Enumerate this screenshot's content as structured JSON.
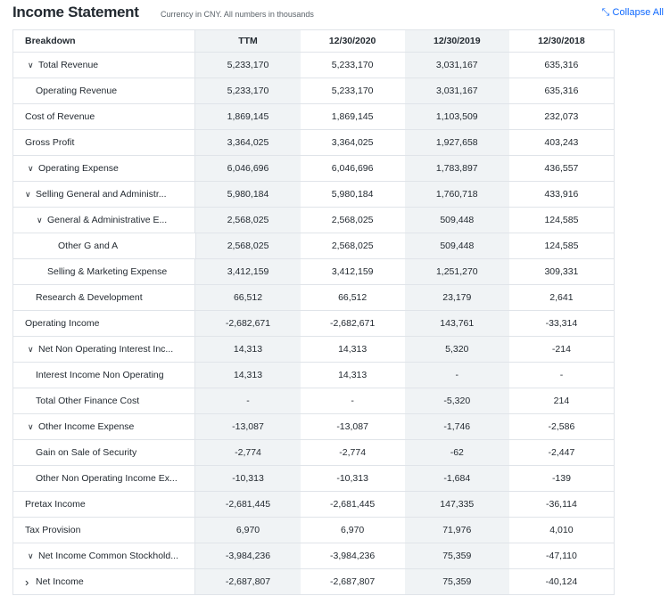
{
  "header": {
    "title": "Income Statement",
    "subtitle": "Currency in CNY. All numbers in thousands",
    "collapse_label": "Collapse All",
    "collapse_icon": "collapse-arrows-icon"
  },
  "columns": [
    "Breakdown",
    "TTM",
    "12/30/2020",
    "12/30/2019",
    "12/30/2018"
  ],
  "rows": [
    {
      "label": "Total Revenue",
      "level": 0,
      "caret": "down",
      "values": [
        "5,233,170",
        "5,233,170",
        "3,031,167",
        "635,316"
      ]
    },
    {
      "label": "Operating Revenue",
      "level": 1,
      "caret": "",
      "values": [
        "5,233,170",
        "5,233,170",
        "3,031,167",
        "635,316"
      ]
    },
    {
      "label": "Cost of Revenue",
      "level": 0,
      "caret": "",
      "values": [
        "1,869,145",
        "1,869,145",
        "1,103,509",
        "232,073"
      ]
    },
    {
      "label": "Gross Profit",
      "level": 0,
      "caret": "",
      "values": [
        "3,364,025",
        "3,364,025",
        "1,927,658",
        "403,243"
      ]
    },
    {
      "label": "Operating Expense",
      "level": 0,
      "caret": "down",
      "values": [
        "6,046,696",
        "6,046,696",
        "1,783,897",
        "436,557"
      ]
    },
    {
      "label": "Selling General and Administr...",
      "level": 1,
      "caret": "down",
      "values": [
        "5,980,184",
        "5,980,184",
        "1,760,718",
        "433,916"
      ]
    },
    {
      "label": "General & Administrative E...",
      "level": 2,
      "caret": "down",
      "values": [
        "2,568,025",
        "2,568,025",
        "509,448",
        "124,585"
      ]
    },
    {
      "label": "Other G and A",
      "level": 3,
      "caret": "",
      "values": [
        "2,568,025",
        "2,568,025",
        "509,448",
        "124,585"
      ]
    },
    {
      "label": "Selling & Marketing Expense",
      "level": 2,
      "caret": "",
      "values": [
        "3,412,159",
        "3,412,159",
        "1,251,270",
        "309,331"
      ]
    },
    {
      "label": "Research & Development",
      "level": 1,
      "caret": "",
      "values": [
        "66,512",
        "66,512",
        "23,179",
        "2,641"
      ]
    },
    {
      "label": "Operating Income",
      "level": 0,
      "caret": "",
      "values": [
        "-2,682,671",
        "-2,682,671",
        "143,761",
        "-33,314"
      ]
    },
    {
      "label": "Net Non Operating Interest Inc...",
      "level": 0,
      "caret": "down",
      "values": [
        "14,313",
        "14,313",
        "5,320",
        "-214"
      ]
    },
    {
      "label": "Interest Income Non Operating",
      "level": 1,
      "caret": "",
      "values": [
        "14,313",
        "14,313",
        "-",
        "-"
      ]
    },
    {
      "label": "Total Other Finance Cost",
      "level": 1,
      "caret": "",
      "values": [
        "-",
        "-",
        "-5,320",
        "214"
      ]
    },
    {
      "label": "Other Income Expense",
      "level": 0,
      "caret": "down",
      "values": [
        "-13,087",
        "-13,087",
        "-1,746",
        "-2,586"
      ]
    },
    {
      "label": "Gain on Sale of Security",
      "level": 1,
      "caret": "",
      "values": [
        "-2,774",
        "-2,774",
        "-62",
        "-2,447"
      ]
    },
    {
      "label": "Other Non Operating Income Ex...",
      "level": 1,
      "caret": "",
      "values": [
        "-10,313",
        "-10,313",
        "-1,684",
        "-139"
      ]
    },
    {
      "label": "Pretax Income",
      "level": 0,
      "caret": "",
      "values": [
        "-2,681,445",
        "-2,681,445",
        "147,335",
        "-36,114"
      ]
    },
    {
      "label": "Tax Provision",
      "level": 0,
      "caret": "",
      "values": [
        "6,970",
        "6,970",
        "71,976",
        "4,010"
      ]
    },
    {
      "label": "Net Income Common Stockhold...",
      "level": 0,
      "caret": "down",
      "values": [
        "-3,984,236",
        "-3,984,236",
        "75,359",
        "-47,110"
      ]
    },
    {
      "label": "Net Income",
      "level": 1,
      "caret": "right",
      "values": [
        "-2,687,807",
        "-2,687,807",
        "75,359",
        "-40,124"
      ]
    }
  ]
}
